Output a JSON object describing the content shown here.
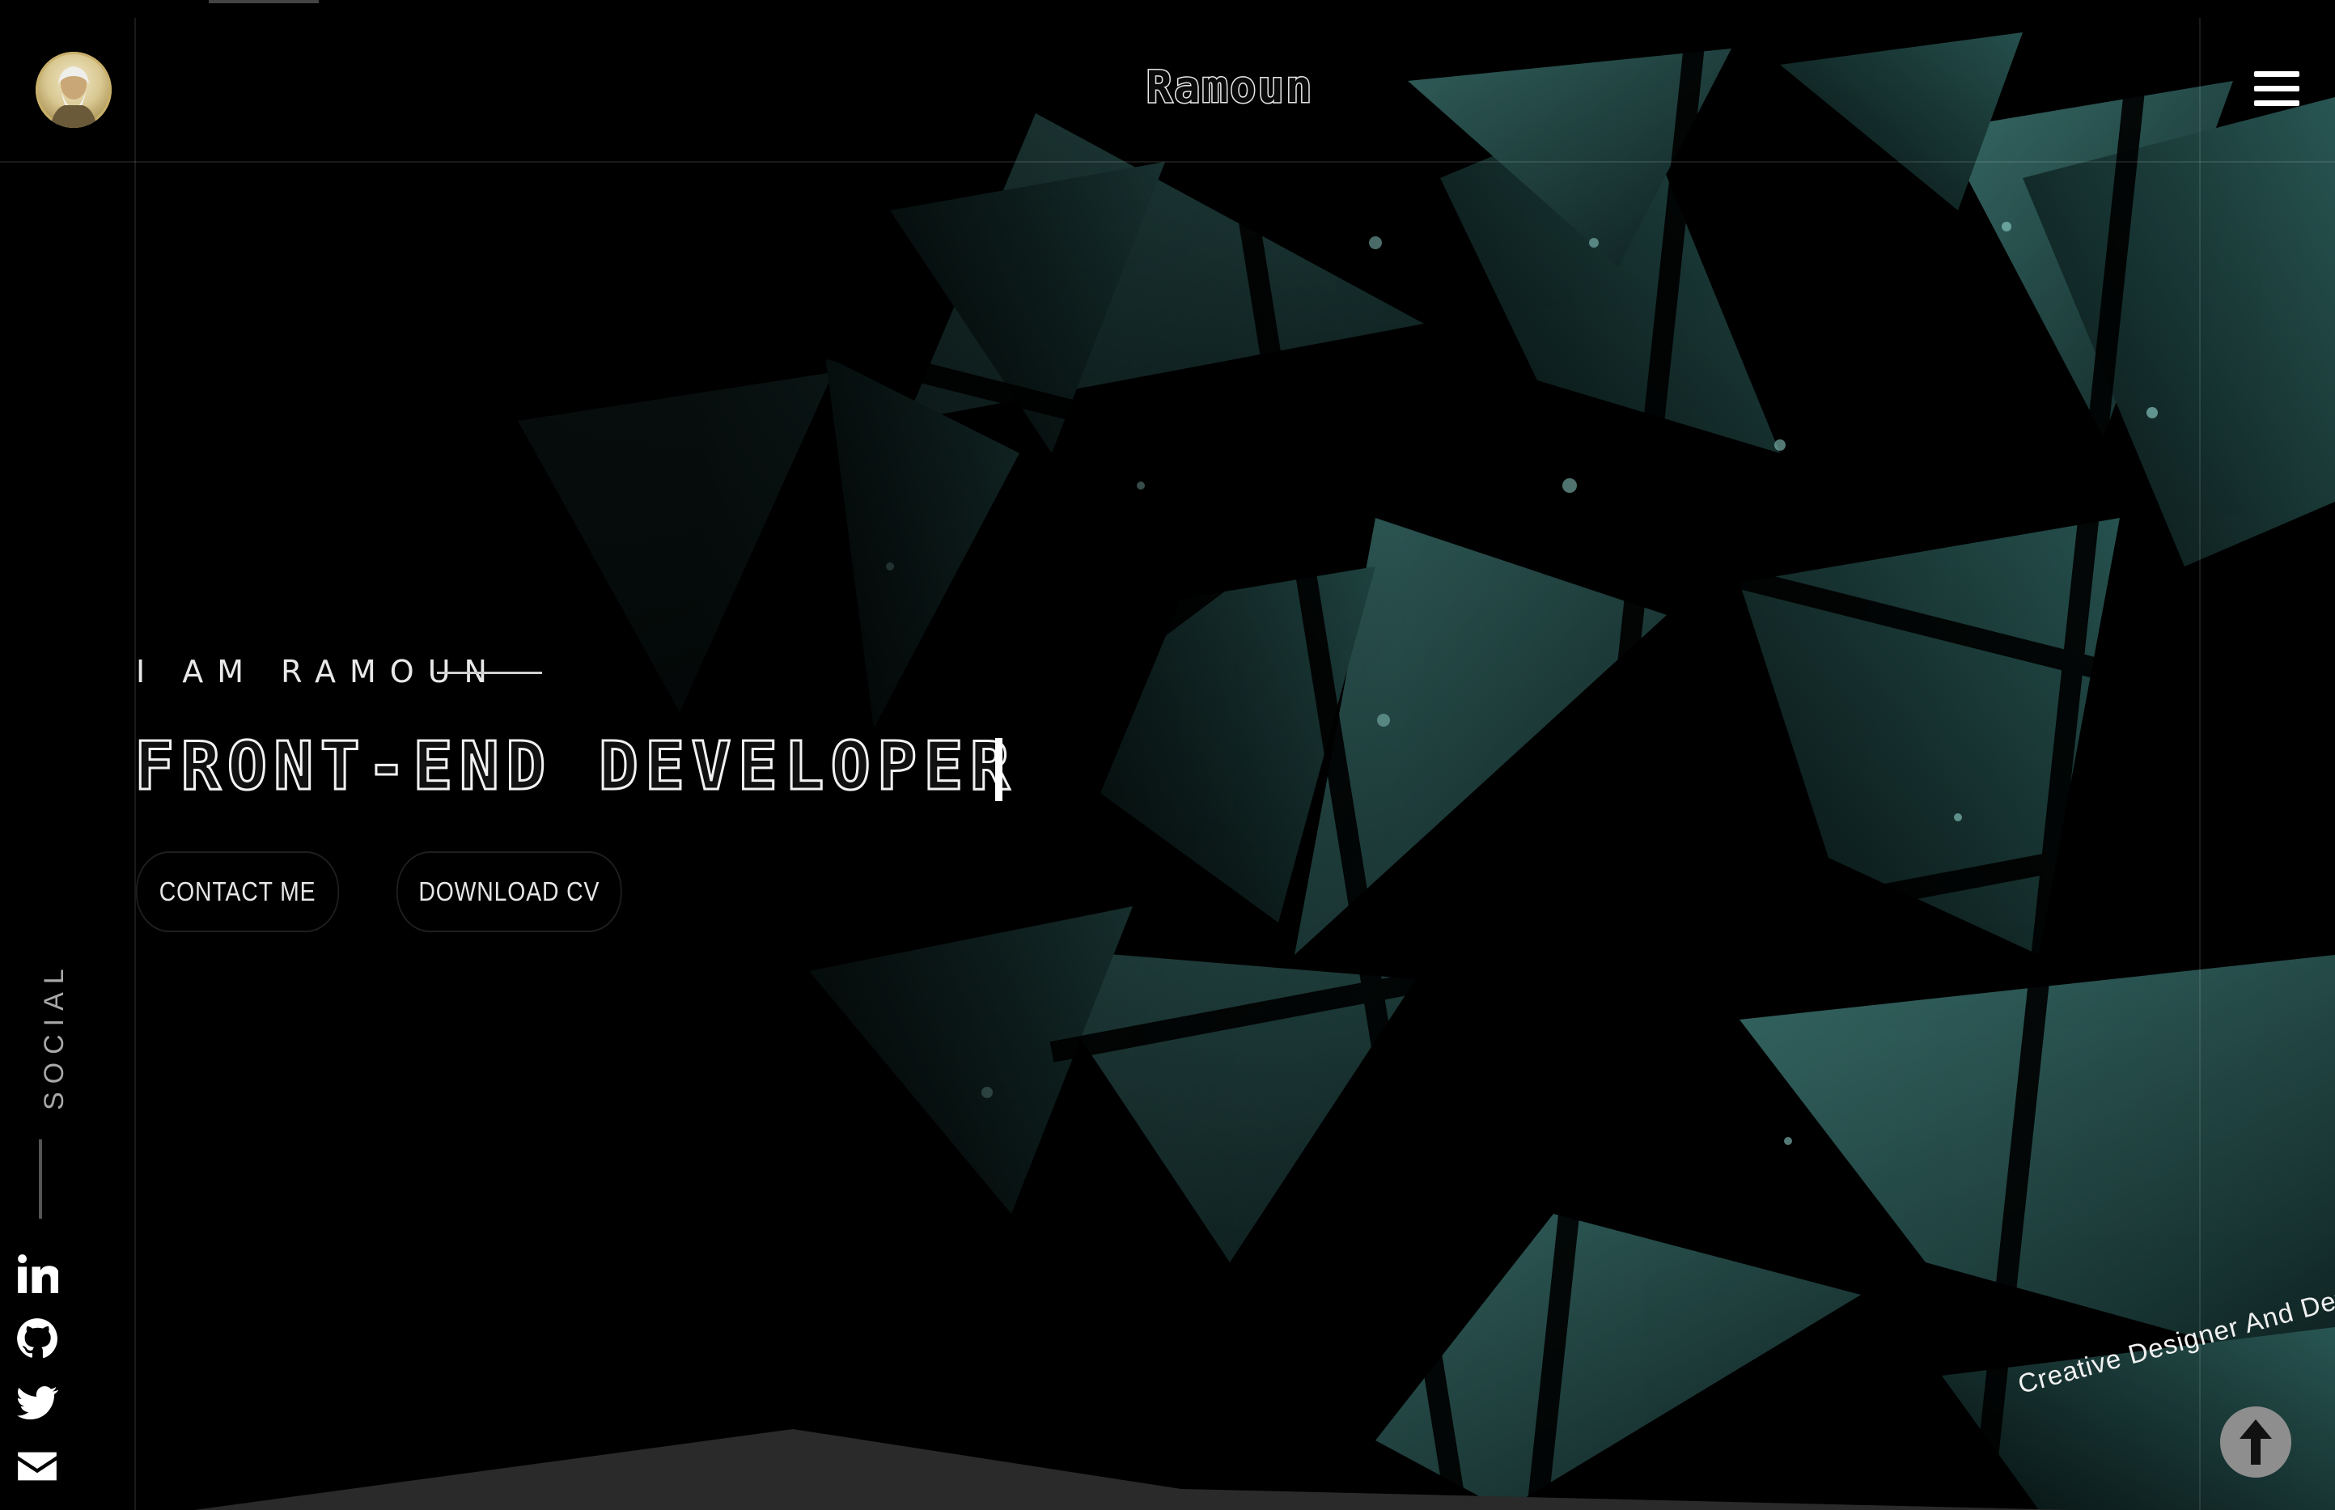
{
  "header": {
    "brand": "Ramoun",
    "menu_icon": "hamburger-menu-icon",
    "avatar_icon": "avatar-portrait"
  },
  "hero": {
    "eyebrow": "I AM RAMOUN",
    "headline": "FRONT-END DEVELOPER",
    "buttons": {
      "contact": "CONTACT ME",
      "download_cv": "DOWNLOAD CV"
    }
  },
  "social": {
    "label": "SOCIAL",
    "items": [
      {
        "icon": "linkedin-icon"
      },
      {
        "icon": "github-icon"
      },
      {
        "icon": "twitter-icon"
      },
      {
        "icon": "envelope-icon"
      }
    ]
  },
  "footer": {
    "tagline": "Creative Designer And Developer",
    "scroll_top_icon": "arrow-up-icon"
  },
  "colors": {
    "background": "#000000",
    "accent_teal": "#2f5f5c",
    "text": "#ffffff",
    "scroll_button": "#8e8e8e"
  }
}
